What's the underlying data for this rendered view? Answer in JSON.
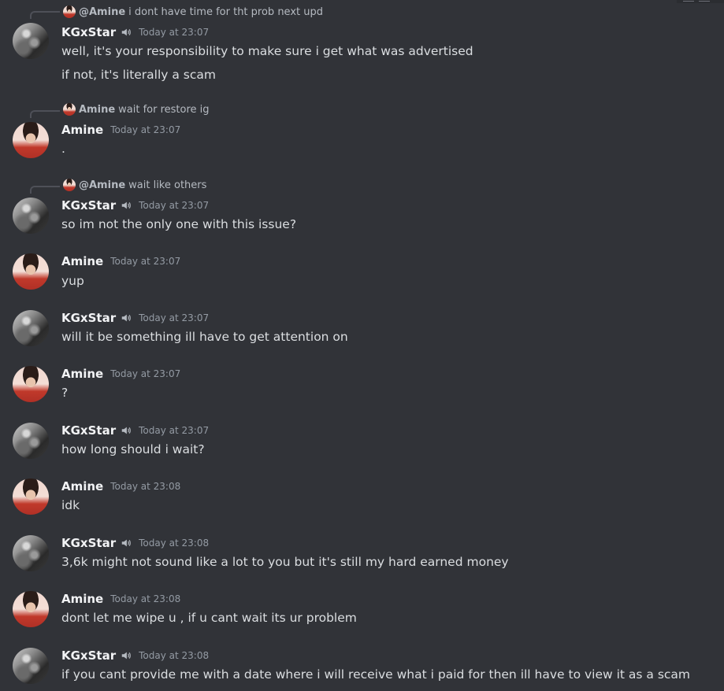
{
  "colors": {
    "background": "#313338",
    "username": "#f2f3f5",
    "message_text": "#dbdee1",
    "timestamp": "#949ba4",
    "reply_text": "#b5bac1"
  },
  "messages": [
    {
      "reply": {
        "author": "@Amine",
        "text": "i dont have time for tht prob next upd"
      },
      "author": "KGxStar",
      "time": "Today at 23:07",
      "has_speaker_icon": true,
      "lines": [
        "well, it's your responsibility to make sure i get what was advertised",
        "if not, it's literally a scam"
      ]
    },
    {
      "reply": {
        "author": "Amine",
        "text": "wait for restore ig"
      },
      "author": "Amine",
      "time": "Today at 23:07",
      "has_speaker_icon": false,
      "lines": [
        "."
      ]
    },
    {
      "reply": {
        "author": "@Amine",
        "text": "wait like others"
      },
      "author": "KGxStar",
      "time": "Today at 23:07",
      "has_speaker_icon": true,
      "lines": [
        "so im not the only one with this issue?"
      ]
    },
    {
      "author": "Amine",
      "time": "Today at 23:07",
      "has_speaker_icon": false,
      "lines": [
        "yup"
      ]
    },
    {
      "author": "KGxStar",
      "time": "Today at 23:07",
      "has_speaker_icon": true,
      "lines": [
        "will it be something ill have to get attention on"
      ]
    },
    {
      "author": "Amine",
      "time": "Today at 23:07",
      "has_speaker_icon": false,
      "lines": [
        "?"
      ]
    },
    {
      "author": "KGxStar",
      "time": "Today at 23:07",
      "has_speaker_icon": true,
      "lines": [
        "how long should i wait?"
      ]
    },
    {
      "author": "Amine",
      "time": "Today at 23:08",
      "has_speaker_icon": false,
      "lines": [
        "idk"
      ]
    },
    {
      "author": "KGxStar",
      "time": "Today at 23:08",
      "has_speaker_icon": true,
      "lines": [
        "3,6k might not sound like a lot to you but it's still my hard earned money"
      ]
    },
    {
      "author": "Amine",
      "time": "Today at 23:08",
      "has_speaker_icon": false,
      "lines": [
        "dont let me wipe u , if u cant wait its ur problem"
      ]
    },
    {
      "author": "KGxStar",
      "time": "Today at 23:08",
      "has_speaker_icon": true,
      "lines": [
        "if you cant provide me with a date where i will receive what i paid for then ill have to view it as a scam"
      ]
    }
  ]
}
